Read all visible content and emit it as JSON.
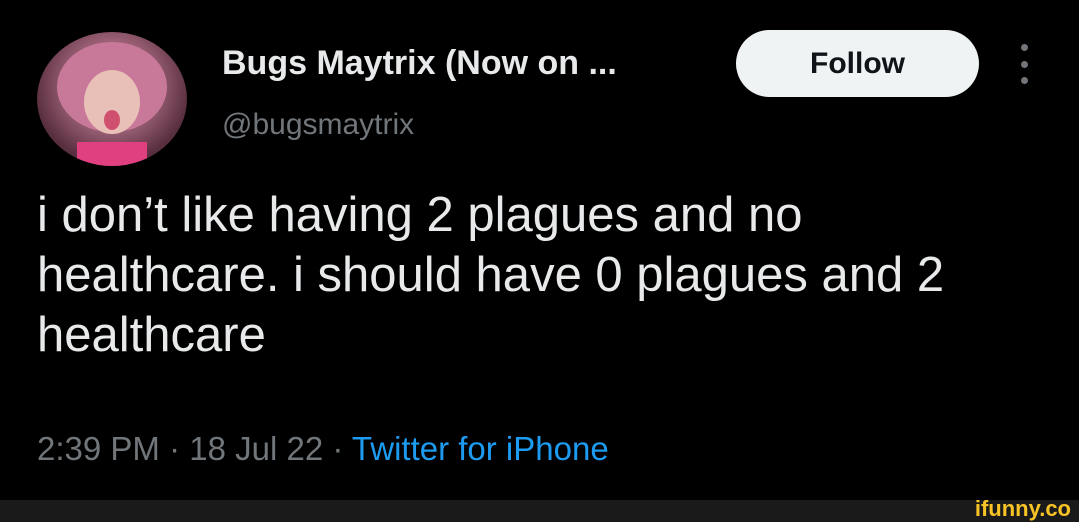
{
  "author": {
    "name": "Bugs Maytrix (Now on ...",
    "handle": "@bugsmaytrix"
  },
  "follow_label": "Follow",
  "tweet_text": "i don’t like having 2 plagues and no healthcare. i should have 0 plagues and 2 healthcare",
  "meta": {
    "time": "2:39 PM",
    "separator1": " · ",
    "date": "18 Jul 22",
    "separator2": " · ",
    "source": "Twitter for iPhone"
  },
  "watermark": "ifunny.co",
  "colors": {
    "link": "#1d9bf0",
    "secondary": "#71767b",
    "primary": "#e7e9ea",
    "watermark": "#f7c325"
  }
}
